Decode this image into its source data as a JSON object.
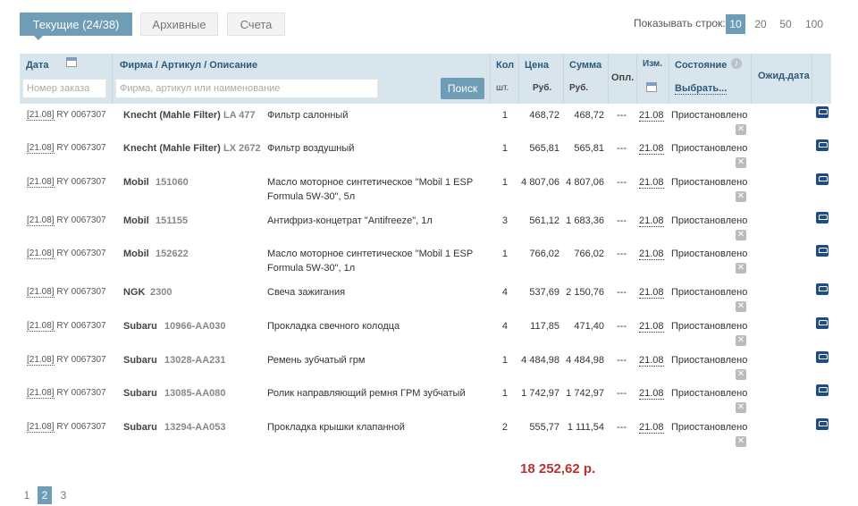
{
  "tabs": [
    {
      "label": "Текущие (24/38)"
    },
    {
      "label": "Архивные"
    },
    {
      "label": "Счета"
    }
  ],
  "rows_per_page": {
    "label": "Показывать строк:",
    "options": [
      "10",
      "20",
      "50",
      "100"
    ],
    "selected": "10"
  },
  "header": {
    "date": "Дата",
    "firm": "Фирма / Артикул / Описание",
    "qty": "Кол",
    "qty_unit": "шт.",
    "price": "Цена",
    "price_unit": "Руб.",
    "sum": "Сумма",
    "sum_unit": "Руб.",
    "paid": "Опл.",
    "changed": "Изм.",
    "state": "Состояние",
    "state_select": "Выбрать...",
    "wait_date": "Ожид.дата",
    "order_placeholder": "Номер заказа",
    "search_placeholder": "Фирма, артикул или наименование",
    "search_button": "Поиск"
  },
  "rows": [
    {
      "date": "[21.08]",
      "order": "RY 0067307",
      "brand": "Knecht (Mahle Filter)",
      "article": "LA 477",
      "desc": "Фильтр салонный",
      "qty": "1",
      "price": "468,72",
      "sum": "468,72",
      "paid": "---",
      "changed": "21.08",
      "state": "Приостановлено"
    },
    {
      "date": "[21.08]",
      "order": "RY 0067307",
      "brand": "Knecht (Mahle Filter)",
      "article": "LX 2672",
      "desc": "Фильтр воздушный",
      "qty": "1",
      "price": "565,81",
      "sum": "565,81",
      "paid": "---",
      "changed": "21.08",
      "state": "Приостановлено"
    },
    {
      "date": "[21.08]",
      "order": "RY 0067307",
      "brand": "Mobil",
      "article": "151060",
      "desc": "Масло моторное синтетическое \"Mobil 1 ESP Formula 5W-30\", 5л",
      "qty": "1",
      "price": "4 807,06",
      "sum": "4 807,06",
      "paid": "---",
      "changed": "21.08",
      "state": "Приостановлено"
    },
    {
      "date": "[21.08]",
      "order": "RY 0067307",
      "brand": "Mobil",
      "article": "151155",
      "desc": "Антифриз-концетрат \"Antifreeze\", 1л",
      "qty": "3",
      "price": "561,12",
      "sum": "1 683,36",
      "paid": "---",
      "changed": "21.08",
      "state": "Приостановлено"
    },
    {
      "date": "[21.08]",
      "order": "RY 0067307",
      "brand": "Mobil",
      "article": "152622",
      "desc": "Масло моторное синтетическое \"Mobil 1 ESP Formula 5W-30\", 1л",
      "qty": "1",
      "price": "766,02",
      "sum": "766,02",
      "paid": "---",
      "changed": "21.08",
      "state": "Приостановлено"
    },
    {
      "date": "[21.08]",
      "order": "RY 0067307",
      "brand": "NGK",
      "article": "2300",
      "desc": "Свеча зажигания",
      "qty": "4",
      "price": "537,69",
      "sum": "2 150,76",
      "paid": "---",
      "changed": "21.08",
      "state": "Приостановлено"
    },
    {
      "date": "[21.08]",
      "order": "RY 0067307",
      "brand": "Subaru",
      "article": "10966-AA030",
      "desc": "Прокладка свечного колодца",
      "qty": "4",
      "price": "117,85",
      "sum": "471,40",
      "paid": "---",
      "changed": "21.08",
      "state": "Приостановлено"
    },
    {
      "date": "[21.08]",
      "order": "RY 0067307",
      "brand": "Subaru",
      "article": "13028-AA231",
      "desc": "Ремень зубчатый грм",
      "qty": "1",
      "price": "4 484,98",
      "sum": "4 484,98",
      "paid": "---",
      "changed": "21.08",
      "state": "Приостановлено"
    },
    {
      "date": "[21.08]",
      "order": "RY 0067307",
      "brand": "Subaru",
      "article": "13085-AA080",
      "desc": "Ролик направляющий ремня ГРМ зубчатый",
      "qty": "1",
      "price": "1 742,97",
      "sum": "1 742,97",
      "paid": "---",
      "changed": "21.08",
      "state": "Приостановлено"
    },
    {
      "date": "[21.08]",
      "order": "RY 0067307",
      "brand": "Subaru",
      "article": "13294-AA053",
      "desc": "Прокладка крышки клапанной",
      "qty": "2",
      "price": "555,77",
      "sum": "1 111,54",
      "paid": "---",
      "changed": "21.08",
      "state": "Приостановлено"
    }
  ],
  "total": "18 252,62 р.",
  "pagination": {
    "pages": [
      "1",
      "2",
      "3"
    ],
    "current": "2"
  }
}
